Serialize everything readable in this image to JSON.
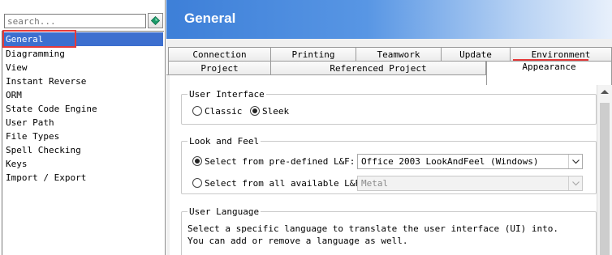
{
  "sidebar": {
    "search_placeholder": "search...",
    "items": [
      {
        "label": "General",
        "selected": true
      },
      {
        "label": "Diagramming"
      },
      {
        "label": "View"
      },
      {
        "label": "Instant Reverse"
      },
      {
        "label": "ORM"
      },
      {
        "label": "State Code Engine"
      },
      {
        "label": "User Path"
      },
      {
        "label": "File Types"
      },
      {
        "label": "Spell Checking"
      },
      {
        "label": "Keys"
      },
      {
        "label": "Import / Export"
      }
    ]
  },
  "header": {
    "title": "General"
  },
  "tabs": {
    "row1": [
      "Connection",
      "Printing",
      "Teamwork",
      "Update",
      "Environment"
    ],
    "row2": [
      "Project",
      "Referenced Project",
      "Appearance"
    ],
    "active": "Appearance"
  },
  "user_interface": {
    "title": "User Interface",
    "options": [
      {
        "label": "Classic",
        "checked": false
      },
      {
        "label": "Sleek",
        "checked": true
      }
    ]
  },
  "look_and_feel": {
    "title": "Look and Feel",
    "predefined_label": "Select from pre-defined L&F:",
    "predefined_value": "Office 2003 LookAndFeel (Windows)",
    "predefined_checked": true,
    "all_label": "Select from all available L&F:",
    "all_value": "Metal",
    "all_checked": false
  },
  "user_language": {
    "title": "User Language",
    "line1": "Select a specific language to translate the user interface (UI) into.",
    "line2": "You can add or remove a language as well."
  },
  "colors": {
    "selection": "#3c6fcf",
    "header_start": "#3d7fd8",
    "highlight_box": "#e53a3a"
  }
}
